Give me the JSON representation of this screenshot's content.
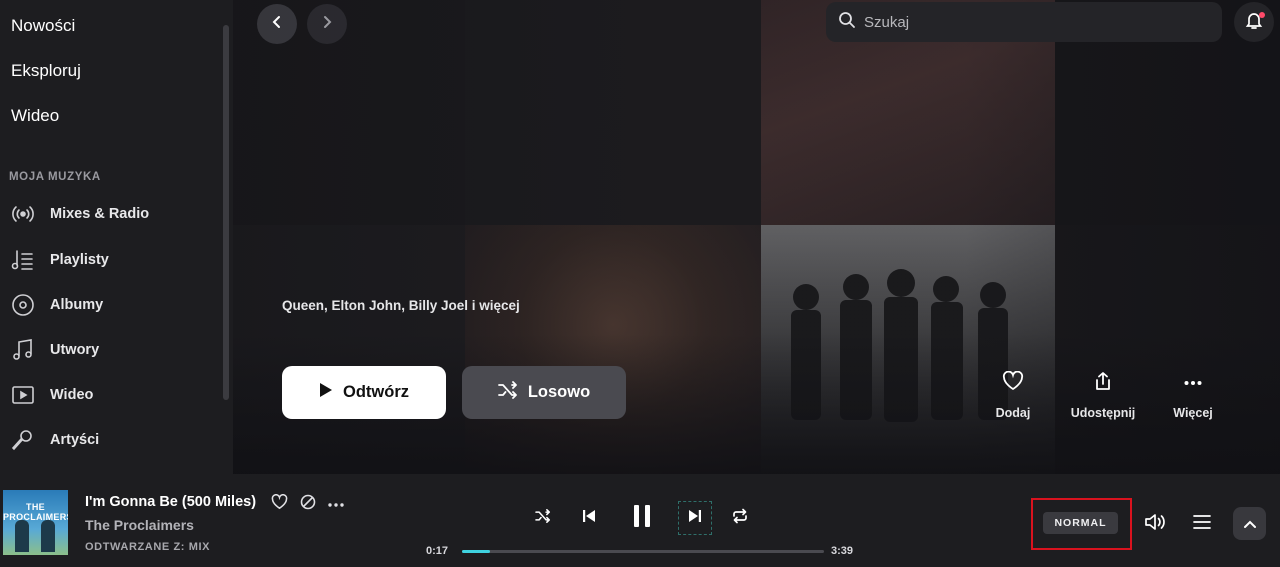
{
  "sidebar": {
    "main_items": [
      "Nowości",
      "Eksploruj",
      "Wideo"
    ],
    "section_label": "MOJA MUZYKA",
    "items": [
      {
        "label": "Mixes & Radio",
        "icon": "radio-icon"
      },
      {
        "label": "Playlisty",
        "icon": "playlist-icon"
      },
      {
        "label": "Albumy",
        "icon": "album-icon"
      },
      {
        "label": "Utwory",
        "icon": "music-note-icon"
      },
      {
        "label": "Wideo",
        "icon": "video-icon"
      },
      {
        "label": "Artyści",
        "icon": "microphone-icon"
      }
    ]
  },
  "header": {
    "search_placeholder": "Szukaj"
  },
  "hero": {
    "artists": "Queen, Elton John, Billy Joel i więcej",
    "play_label": "Odtwórz",
    "shuffle_label": "Losowo",
    "actions": {
      "add_label": "Dodaj",
      "share_label": "Udostępnij",
      "more_label": "Więcej"
    }
  },
  "player": {
    "cover_text": "THE PROCLAIMERS",
    "track_title": "I'm Gonna Be (500 Miles)",
    "track_artist": "The Proclaimers",
    "playing_from": "ODTWARZANE Z: MIX",
    "elapsed": "0:17",
    "duration": "3:39",
    "progress_fraction": 0.0776,
    "quality": "NORMAL"
  },
  "colors": {
    "accent": "#3fd2e0",
    "highlight_box": "#d9121e",
    "notification_dot": "#ff4a6a"
  }
}
